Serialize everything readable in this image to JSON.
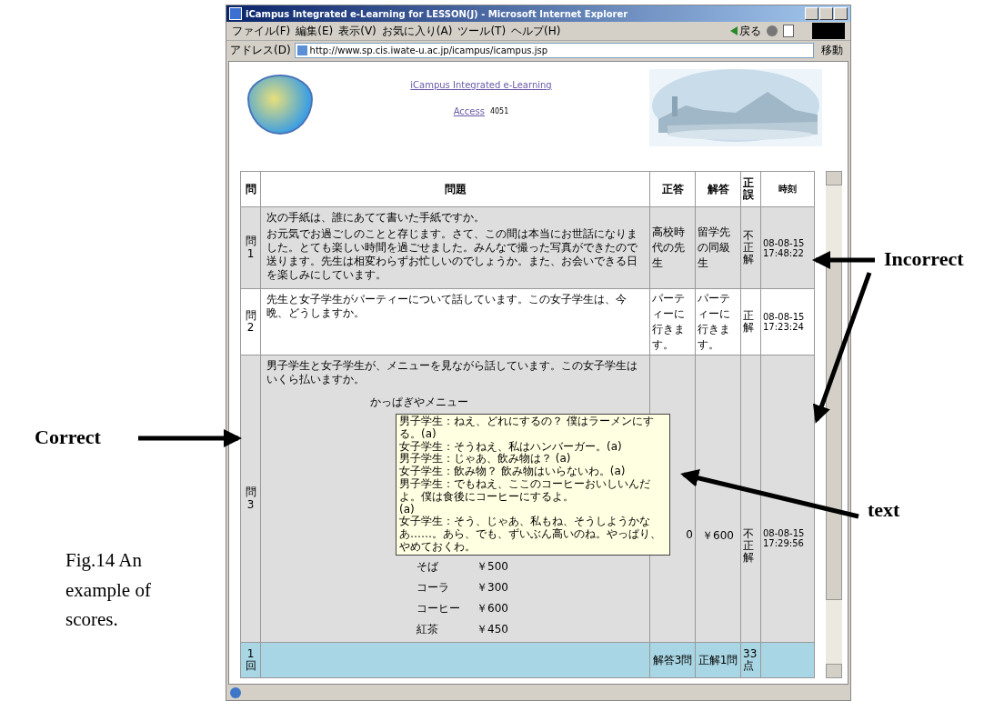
{
  "window": {
    "title": "iCampus Integrated e-Learning for LESSON(J) - Microsoft Internet Explorer"
  },
  "menu": [
    "ファイル(F)",
    "編集(E)",
    "表示(V)",
    "お気に入り(A)",
    "ツール(T)",
    "ヘルプ(H)"
  ],
  "toolbar": {
    "back": "戻る"
  },
  "address": {
    "label": "アドレス(D)",
    "url": "http://www.sp.cis.iwate-u.ac.jp/icampus/icampus.jsp",
    "go": "移動"
  },
  "header": {
    "title_link": "iCampus Integrated e-Learning",
    "access_link": "Access",
    "access_count": "4051"
  },
  "table": {
    "columns": [
      "問",
      "問題",
      "正答",
      "解答",
      "正誤",
      "時刻"
    ],
    "rows": [
      {
        "number": "問1",
        "correct": false,
        "question": [
          "次の手紙は、誰にあてて書いた手紙ですか。",
          "お元気でお過ごしのことと存じます。さて、この間は本当にお世話になりました。とても楽しい時間を過ごせました。みんなで撮った写真ができたので送ります。先生は相変わらずお忙しいのでしょうか。また、お会いできる日を楽しみにしています。"
        ],
        "answer_key": "高校時代の先生",
        "answer": "留学先の同級生",
        "result": "不正解",
        "time": "08-08-15 17:48:22"
      },
      {
        "number": "問2",
        "correct": true,
        "question": [
          "先生と女子学生がパーティーについて話しています。この女子学生は、今晩、どうしますか。"
        ],
        "answer_key": "パーティーに行きます。",
        "answer": "パーティーに行きます。",
        "result": "正解",
        "time": "08-08-15 17:23:24"
      },
      {
        "number": "問3",
        "correct": false,
        "question": [
          "男子学生と女子学生が、メニューを見ながら話しています。この女子学生はいくら払いますか。"
        ],
        "menu_title": "かっぱぎやメニュー",
        "menu_items": [
          {
            "name": "そば",
            "price": "￥500"
          },
          {
            "name": "コーラ",
            "price": "￥300"
          },
          {
            "name": "コーヒー",
            "price": "￥600"
          },
          {
            "name": "紅茶",
            "price": "￥450"
          }
        ],
        "answer_key": "0",
        "answer": "￥600",
        "result": "不正解",
        "time": "08-08-15 17:29:56"
      }
    ],
    "total": {
      "label": "1回",
      "answer_count": "解答3問",
      "correct_count": "正解1問",
      "score": "33点"
    }
  },
  "tooltip": {
    "lines": [
      "男子学生：ねえ、どれにするの？ 僕はラーメンにする。(a)",
      "女子学生：そうねえ、私はハンバーガー。(a)",
      "男子学生：じゃあ、飲み物は？ (a)",
      "女子学生：飲み物？ 飲み物はいらないわ。(a)",
      "男子学生：でもねえ、ここのコーヒーおいしいんだよ。僕は食後にコーヒーにするよ。",
      "(a)",
      "女子学生：そう、じゃあ、私もね、そうしようかなあ……。あら、でも、ずいぶん高いのね。やっぱり、やめておくわ。"
    ]
  },
  "annotations": [
    {
      "kind": "correct",
      "text": "Correct"
    },
    {
      "kind": "incorrect",
      "text": "Incorrect"
    },
    {
      "kind": "text",
      "text": "text"
    }
  ],
  "caption": "Fig.14 An example of scores."
}
